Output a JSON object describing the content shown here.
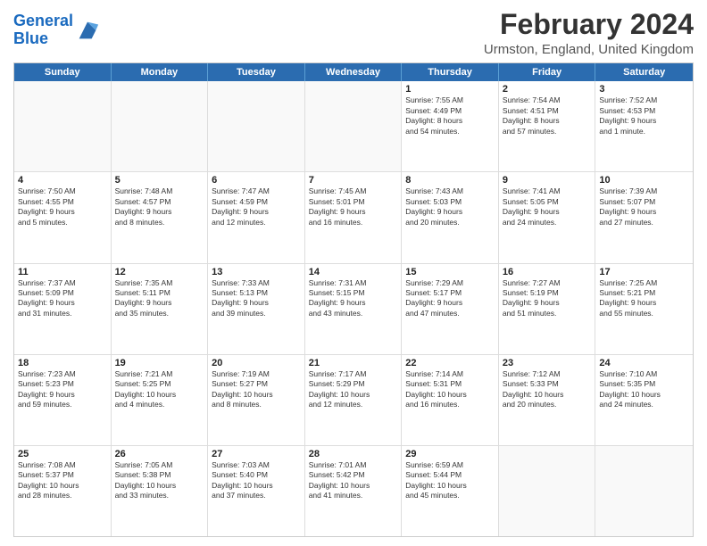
{
  "header": {
    "logo_line1": "General",
    "logo_line2": "Blue",
    "month_year": "February 2024",
    "location": "Urmston, England, United Kingdom"
  },
  "days_of_week": [
    "Sunday",
    "Monday",
    "Tuesday",
    "Wednesday",
    "Thursday",
    "Friday",
    "Saturday"
  ],
  "weeks": [
    [
      {
        "day": "",
        "info": "",
        "empty": true
      },
      {
        "day": "",
        "info": "",
        "empty": true
      },
      {
        "day": "",
        "info": "",
        "empty": true
      },
      {
        "day": "",
        "info": "",
        "empty": true
      },
      {
        "day": "1",
        "info": "Sunrise: 7:55 AM\nSunset: 4:49 PM\nDaylight: 8 hours\nand 54 minutes."
      },
      {
        "day": "2",
        "info": "Sunrise: 7:54 AM\nSunset: 4:51 PM\nDaylight: 8 hours\nand 57 minutes."
      },
      {
        "day": "3",
        "info": "Sunrise: 7:52 AM\nSunset: 4:53 PM\nDaylight: 9 hours\nand 1 minute."
      }
    ],
    [
      {
        "day": "4",
        "info": "Sunrise: 7:50 AM\nSunset: 4:55 PM\nDaylight: 9 hours\nand 5 minutes."
      },
      {
        "day": "5",
        "info": "Sunrise: 7:48 AM\nSunset: 4:57 PM\nDaylight: 9 hours\nand 8 minutes."
      },
      {
        "day": "6",
        "info": "Sunrise: 7:47 AM\nSunset: 4:59 PM\nDaylight: 9 hours\nand 12 minutes."
      },
      {
        "day": "7",
        "info": "Sunrise: 7:45 AM\nSunset: 5:01 PM\nDaylight: 9 hours\nand 16 minutes."
      },
      {
        "day": "8",
        "info": "Sunrise: 7:43 AM\nSunset: 5:03 PM\nDaylight: 9 hours\nand 20 minutes."
      },
      {
        "day": "9",
        "info": "Sunrise: 7:41 AM\nSunset: 5:05 PM\nDaylight: 9 hours\nand 24 minutes."
      },
      {
        "day": "10",
        "info": "Sunrise: 7:39 AM\nSunset: 5:07 PM\nDaylight: 9 hours\nand 27 minutes."
      }
    ],
    [
      {
        "day": "11",
        "info": "Sunrise: 7:37 AM\nSunset: 5:09 PM\nDaylight: 9 hours\nand 31 minutes."
      },
      {
        "day": "12",
        "info": "Sunrise: 7:35 AM\nSunset: 5:11 PM\nDaylight: 9 hours\nand 35 minutes."
      },
      {
        "day": "13",
        "info": "Sunrise: 7:33 AM\nSunset: 5:13 PM\nDaylight: 9 hours\nand 39 minutes."
      },
      {
        "day": "14",
        "info": "Sunrise: 7:31 AM\nSunset: 5:15 PM\nDaylight: 9 hours\nand 43 minutes."
      },
      {
        "day": "15",
        "info": "Sunrise: 7:29 AM\nSunset: 5:17 PM\nDaylight: 9 hours\nand 47 minutes."
      },
      {
        "day": "16",
        "info": "Sunrise: 7:27 AM\nSunset: 5:19 PM\nDaylight: 9 hours\nand 51 minutes."
      },
      {
        "day": "17",
        "info": "Sunrise: 7:25 AM\nSunset: 5:21 PM\nDaylight: 9 hours\nand 55 minutes."
      }
    ],
    [
      {
        "day": "18",
        "info": "Sunrise: 7:23 AM\nSunset: 5:23 PM\nDaylight: 9 hours\nand 59 minutes."
      },
      {
        "day": "19",
        "info": "Sunrise: 7:21 AM\nSunset: 5:25 PM\nDaylight: 10 hours\nand 4 minutes."
      },
      {
        "day": "20",
        "info": "Sunrise: 7:19 AM\nSunset: 5:27 PM\nDaylight: 10 hours\nand 8 minutes."
      },
      {
        "day": "21",
        "info": "Sunrise: 7:17 AM\nSunset: 5:29 PM\nDaylight: 10 hours\nand 12 minutes."
      },
      {
        "day": "22",
        "info": "Sunrise: 7:14 AM\nSunset: 5:31 PM\nDaylight: 10 hours\nand 16 minutes."
      },
      {
        "day": "23",
        "info": "Sunrise: 7:12 AM\nSunset: 5:33 PM\nDaylight: 10 hours\nand 20 minutes."
      },
      {
        "day": "24",
        "info": "Sunrise: 7:10 AM\nSunset: 5:35 PM\nDaylight: 10 hours\nand 24 minutes."
      }
    ],
    [
      {
        "day": "25",
        "info": "Sunrise: 7:08 AM\nSunset: 5:37 PM\nDaylight: 10 hours\nand 28 minutes."
      },
      {
        "day": "26",
        "info": "Sunrise: 7:05 AM\nSunset: 5:38 PM\nDaylight: 10 hours\nand 33 minutes."
      },
      {
        "day": "27",
        "info": "Sunrise: 7:03 AM\nSunset: 5:40 PM\nDaylight: 10 hours\nand 37 minutes."
      },
      {
        "day": "28",
        "info": "Sunrise: 7:01 AM\nSunset: 5:42 PM\nDaylight: 10 hours\nand 41 minutes."
      },
      {
        "day": "29",
        "info": "Sunrise: 6:59 AM\nSunset: 5:44 PM\nDaylight: 10 hours\nand 45 minutes."
      },
      {
        "day": "",
        "info": "",
        "empty": true
      },
      {
        "day": "",
        "info": "",
        "empty": true
      }
    ]
  ]
}
